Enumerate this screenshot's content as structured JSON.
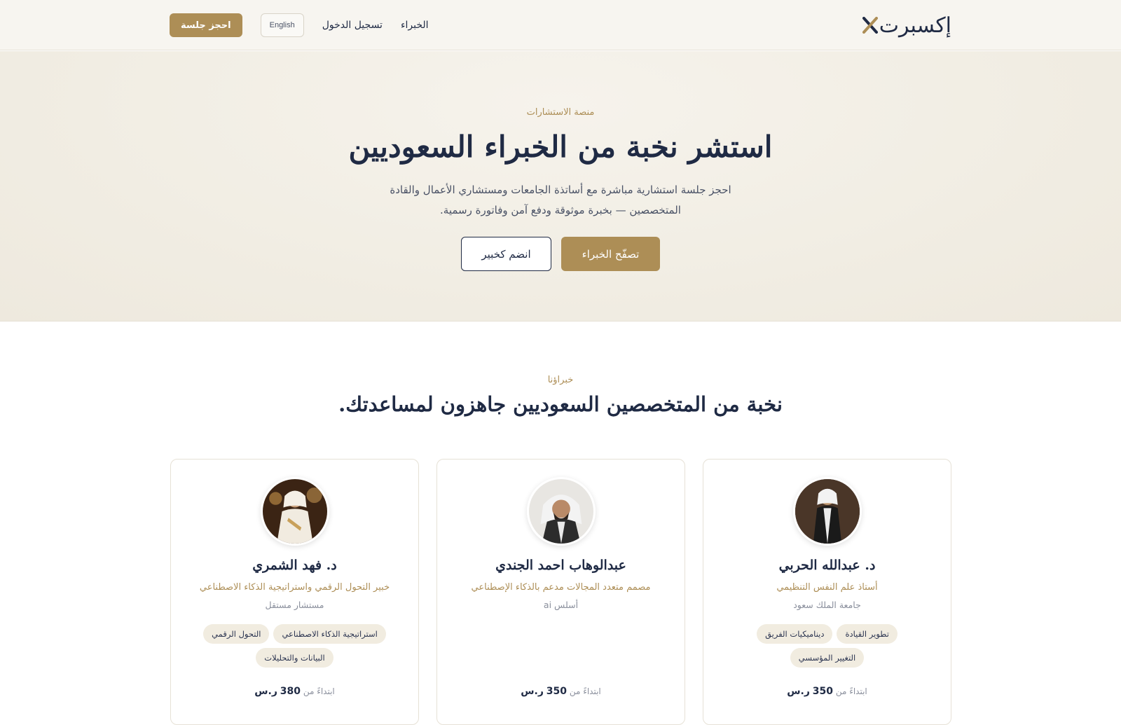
{
  "header": {
    "logo_text": "إكسبرت",
    "nav_experts": "الخبراء",
    "nav_login": "تسجيل الدخول",
    "lang_button": "English",
    "book_button": "احجز جلسة"
  },
  "hero": {
    "eyebrow": "منصة الاستشارات",
    "title": "استشر نخبة من الخبراء السعوديين",
    "subtitle": "احجز جلسة استشارية مباشرة مع أساتذة الجامعات ومستشاري الأعمال والقادة المتخصصين — بخبرة موثوقة ودفع آمن وفاتورة رسمية.",
    "primary_cta": "تصفّح الخبراء",
    "secondary_cta": "انضم كخبير"
  },
  "experts_section": {
    "eyebrow": "خبراؤنا",
    "title": "نخبة من المتخصصين السعوديين جاهزون لمساعدتك.",
    "cards": [
      {
        "name": "د. عبدالله الحربي",
        "role": "أستاذ علم النفس التنظيمي",
        "org": "جامعة الملك سعود",
        "tags": [
          "تطوير القيادة",
          "ديناميكيات الفريق",
          "التغيير المؤسسي"
        ],
        "price_prefix": "ابتداءً من",
        "price_value": "350",
        "price_currency": "ر.س"
      },
      {
        "name": "عبدالوهاب احمد الجندي",
        "role": "مصمم متعدد المجالات مدعم بالذكاء الإصطناعي",
        "org": "أسلس ai",
        "tags": [],
        "price_prefix": "ابتداءً من",
        "price_value": "350",
        "price_currency": "ر.س"
      },
      {
        "name": "د. فهد الشمري",
        "role": "خبير التحول الرقمي واستراتيجية الذكاء الاصطناعي",
        "org": "مستشار مستقل",
        "tags": [
          "استراتيجية الذكاء الاصطناعي",
          "التحول الرقمي",
          "البيانات والتحليلات"
        ],
        "price_prefix": "ابتداءً من",
        "price_value": "380",
        "price_currency": "ر.س"
      }
    ]
  },
  "colors": {
    "accent": "#ad8e56",
    "navy": "#1f2a44",
    "tag_bg": "#f1ece0"
  }
}
